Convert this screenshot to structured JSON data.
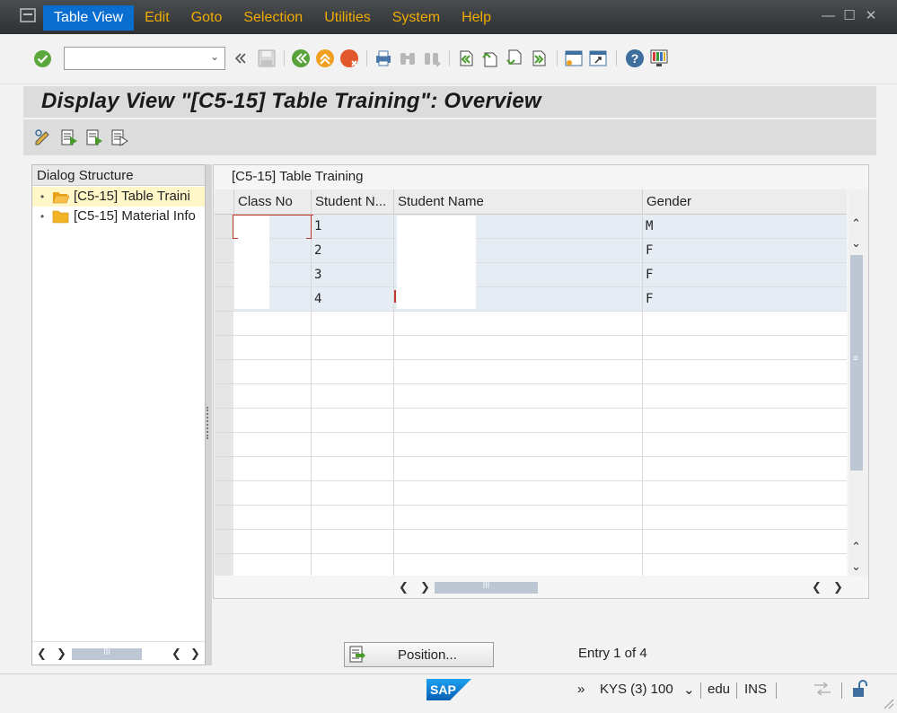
{
  "menu": {
    "items": [
      {
        "label": "Table View",
        "active": true
      },
      {
        "label": "Edit",
        "active": false
      },
      {
        "label": "Goto",
        "active": false
      },
      {
        "label": "Selection",
        "active": false
      },
      {
        "label": "Utilities",
        "active": false
      },
      {
        "label": "System",
        "active": false
      },
      {
        "label": "Help",
        "active": false
      }
    ],
    "window_controls": [
      "minimize-icon",
      "maximize-icon",
      "close-icon"
    ]
  },
  "toolbar": {
    "command_field": {
      "value": "",
      "placeholder": ""
    },
    "icons": [
      "enter-icon",
      "expand-icon",
      "save-icon",
      "back-icon",
      "exit-icon",
      "cancel-icon",
      "print-icon",
      "find-icon",
      "find-next-icon",
      "first-page-icon",
      "previous-page-icon",
      "next-page-icon",
      "last-page-icon",
      "create-session-icon",
      "shortcut-icon",
      "help-icon",
      "customize-layout-icon"
    ]
  },
  "title": "Display View \"[C5-15] Table Training\": Overview",
  "app_toolbar": {
    "icons": [
      "display-change-icon",
      "select-all-icon",
      "select-block-icon",
      "deselect-all-icon"
    ]
  },
  "dialog_structure": {
    "header": "Dialog Structure",
    "items": [
      {
        "label": "[C5-15] Table Traini",
        "selected": true,
        "open": true
      },
      {
        "label": "[C5-15] Material Info",
        "selected": false,
        "open": false
      }
    ]
  },
  "table": {
    "title": "[C5-15] Table Training",
    "columns": [
      "Class No",
      "Student N...",
      "Student Name",
      "Gender"
    ],
    "rows": [
      {
        "class_no": "",
        "student_no": "1",
        "student_name": "",
        "gender": "M"
      },
      {
        "class_no": "",
        "student_no": "2",
        "student_name": "",
        "gender": "F"
      },
      {
        "class_no": "",
        "student_no": "3",
        "student_name": "",
        "gender": "F"
      },
      {
        "class_no": "",
        "student_no": "4",
        "student_name": "",
        "gender": "F"
      }
    ]
  },
  "position_button": {
    "label": "Position..."
  },
  "entry_info": "Entry 1 of 4",
  "status_bar": {
    "logo": "SAP",
    "system": "KYS (3) 100",
    "server": "edu",
    "mode": "INS"
  },
  "colors": {
    "menubar_bg": "#3a3d40",
    "menu_text": "#f0ab00",
    "menu_active_bg": "#0a6ed1",
    "selected_tree_bg": "#fff7c8",
    "filled_row_bg": "#e6ecf3"
  }
}
